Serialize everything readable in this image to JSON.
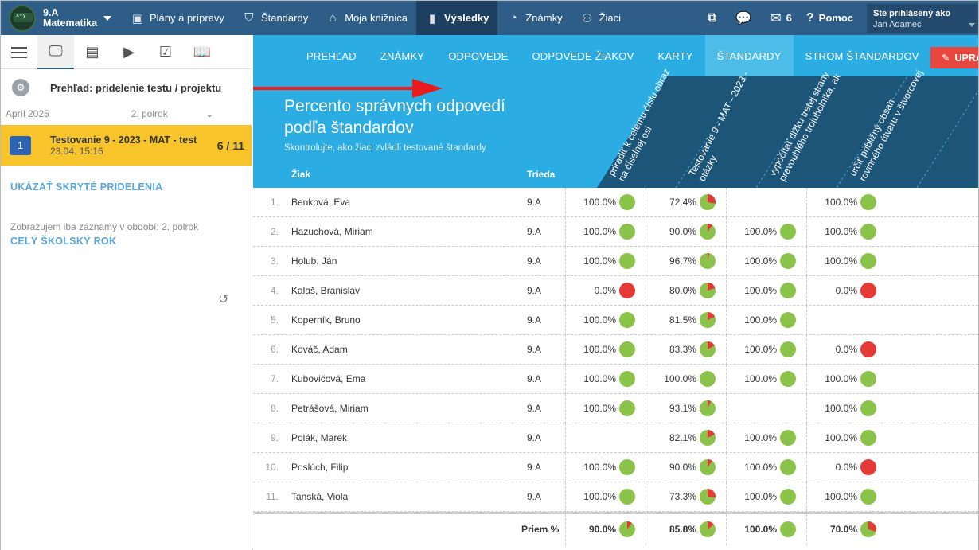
{
  "topbar": {
    "class_name": "9.A",
    "subject": "Matematika",
    "nav": [
      {
        "label": "Plány a prípravy",
        "icon": "briefcase-icon",
        "glyph": "▣"
      },
      {
        "label": "Štandardy",
        "icon": "shield-icon",
        "glyph": "⛉"
      },
      {
        "label": "Moja knižnica",
        "icon": "library-icon",
        "glyph": "⌂"
      },
      {
        "label": "Výsledky",
        "icon": "bar-chart-icon",
        "glyph": "▮"
      },
      {
        "label": "Známky",
        "icon": "grades-icon",
        "glyph": "◔"
      },
      {
        "label": "Žiaci",
        "icon": "students-icon",
        "glyph": "⚇"
      }
    ],
    "messages_count": "6",
    "help_label": "Pomoc",
    "user_label": "Ste prihlásený ako",
    "user_name": "Ján Adamec"
  },
  "sidebar": {
    "title": "Prehľad: pridelenie testu / projektu",
    "period_month": "Apríl 2025",
    "period_semester": "2. polrok",
    "assignment": {
      "number": "1",
      "name": "Testovanie 9 - 2023 - MAT - test",
      "date": "23.04. 15:16",
      "score": "6 / 11"
    },
    "show_hidden": "UKÁZAŤ SKRYTÉ PRIDELENIA",
    "note": "Zobrazujem iba záznamy v období: 2. polrok",
    "whole_year": "CELÝ ŠKOLSKÝ ROK"
  },
  "tabs": [
    "PREHĽAD",
    "ZNÁMKY",
    "ODPOVEDE",
    "ODPOVEDE ŽIAKOV",
    "KARTY",
    "ŠTANDARDY",
    "STROM ŠTANDARDOV"
  ],
  "edit_button": "UPRA",
  "banner": {
    "title_line1": "Percento správnych odpovedí",
    "title_line2": "podľa štandardov",
    "subtitle": "Skontrolujte, ako žiaci zvládli testované štandardy",
    "col_student": "Žiak",
    "col_class": "Trieda",
    "standards": [
      {
        "l1": "priradiť k celému číslu obraz",
        "l2": "na číselnej osi"
      },
      {
        "l1": "Testovanie 9 - MAT - 2023 -",
        "l2": "otázky"
      },
      {
        "l1": "vypočítať dĺžku tretej strany",
        "l2": "pravouhlého trojuholníka, ak"
      },
      {
        "l1": "určiť približný obsah",
        "l2": "rovinného útvaru v štvorcovej"
      }
    ]
  },
  "colors": {
    "correct": "#8bc34a",
    "wrong": "#e53935"
  },
  "rows": [
    {
      "idx": "1.",
      "name": "Benková, Eva",
      "cls": "9.A",
      "vals": [
        "100.0%",
        "72.4%",
        "",
        "100.0%"
      ],
      "nums": [
        1.0,
        0.724,
        null,
        1.0
      ]
    },
    {
      "idx": "2.",
      "name": "Hazuchová, Miriam",
      "cls": "9.A",
      "vals": [
        "100.0%",
        "90.0%",
        "100.0%",
        "100.0%"
      ],
      "nums": [
        1.0,
        0.9,
        1.0,
        1.0
      ]
    },
    {
      "idx": "3.",
      "name": "Holub, Ján",
      "cls": "9.A",
      "vals": [
        "100.0%",
        "96.7%",
        "100.0%",
        "100.0%"
      ],
      "nums": [
        1.0,
        0.967,
        1.0,
        1.0
      ]
    },
    {
      "idx": "4.",
      "name": "Kalaš, Branislav",
      "cls": "9.A",
      "vals": [
        "0.0%",
        "80.0%",
        "100.0%",
        "0.0%"
      ],
      "nums": [
        0.0,
        0.8,
        1.0,
        0.0
      ]
    },
    {
      "idx": "5.",
      "name": "Koperník, Bruno",
      "cls": "9.A",
      "vals": [
        "100.0%",
        "81.5%",
        "100.0%",
        ""
      ],
      "nums": [
        1.0,
        0.815,
        1.0,
        null
      ]
    },
    {
      "idx": "6.",
      "name": "Kováč, Adam",
      "cls": "9.A",
      "vals": [
        "100.0%",
        "83.3%",
        "100.0%",
        "0.0%"
      ],
      "nums": [
        1.0,
        0.833,
        1.0,
        0.0
      ]
    },
    {
      "idx": "7.",
      "name": "Kubovičová, Ema",
      "cls": "9.A",
      "vals": [
        "100.0%",
        "100.0%",
        "100.0%",
        "100.0%"
      ],
      "nums": [
        1.0,
        1.0,
        1.0,
        1.0
      ]
    },
    {
      "idx": "8.",
      "name": "Petrášová, Miriam",
      "cls": "9.A",
      "vals": [
        "100.0%",
        "93.1%",
        "",
        "100.0%"
      ],
      "nums": [
        1.0,
        0.931,
        null,
        1.0
      ]
    },
    {
      "idx": "9.",
      "name": "Polák, Marek",
      "cls": "9.A",
      "vals": [
        "",
        "82.1%",
        "100.0%",
        "100.0%"
      ],
      "nums": [
        null,
        0.821,
        1.0,
        1.0
      ]
    },
    {
      "idx": "10.",
      "name": "Poslúch, Filip",
      "cls": "9.A",
      "vals": [
        "100.0%",
        "90.0%",
        "100.0%",
        "0.0%"
      ],
      "nums": [
        1.0,
        0.9,
        1.0,
        0.0
      ]
    },
    {
      "idx": "11.",
      "name": "Tanská, Viola",
      "cls": "9.A",
      "vals": [
        "100.0%",
        "73.3%",
        "100.0%",
        "100.0%"
      ],
      "nums": [
        1.0,
        0.733,
        1.0,
        1.0
      ]
    }
  ],
  "average": {
    "label": "Priem %",
    "vals": [
      "90.0%",
      "85.8%",
      "100.0%",
      "70.0%"
    ],
    "nums": [
      0.9,
      0.858,
      1.0,
      0.7
    ]
  }
}
